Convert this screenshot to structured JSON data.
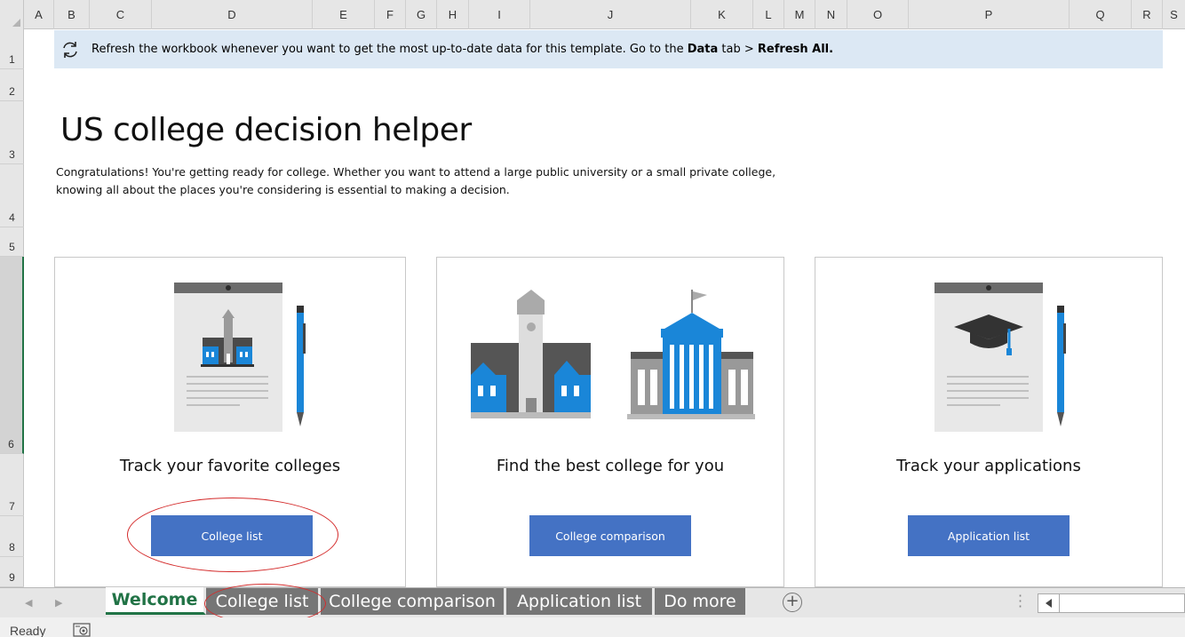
{
  "grid": {
    "columns": [
      "A",
      "B",
      "C",
      "D",
      "E",
      "F",
      "G",
      "H",
      "I",
      "J",
      "K",
      "L",
      "M",
      "N",
      "O",
      "P",
      "Q",
      "R",
      "S"
    ],
    "rows": [
      "1",
      "2",
      "3",
      "4",
      "5",
      "6",
      "7",
      "8",
      "9"
    ]
  },
  "banner": {
    "text_before": "Refresh the workbook whenever you want to get the most up-to-date data for this template. Go to the ",
    "data_tab": "Data",
    "text_mid": " tab  > ",
    "refresh_all": "Refresh All."
  },
  "page": {
    "title": "US college decision helper",
    "intro_line1": "Congratulations! You're getting ready for college. Whether you want to attend a large public university or a small private college,",
    "intro_line2": "knowing all about the places you're considering is essential to making a decision."
  },
  "cards": [
    {
      "title": "Track your favorite colleges",
      "button": "College list"
    },
    {
      "title": "Find the best college for you",
      "button": "College comparison"
    },
    {
      "title": "Track your applications",
      "button": "Application list"
    }
  ],
  "sheet_tabs": [
    "Welcome",
    "College list",
    "College comparison",
    "Application list",
    "Do more"
  ],
  "status": {
    "ready": "Ready"
  },
  "colors": {
    "accent": "#4472c4",
    "excel_green": "#217346",
    "annotation_red": "#d42c2c",
    "banner_bg": "#dce8f4"
  }
}
